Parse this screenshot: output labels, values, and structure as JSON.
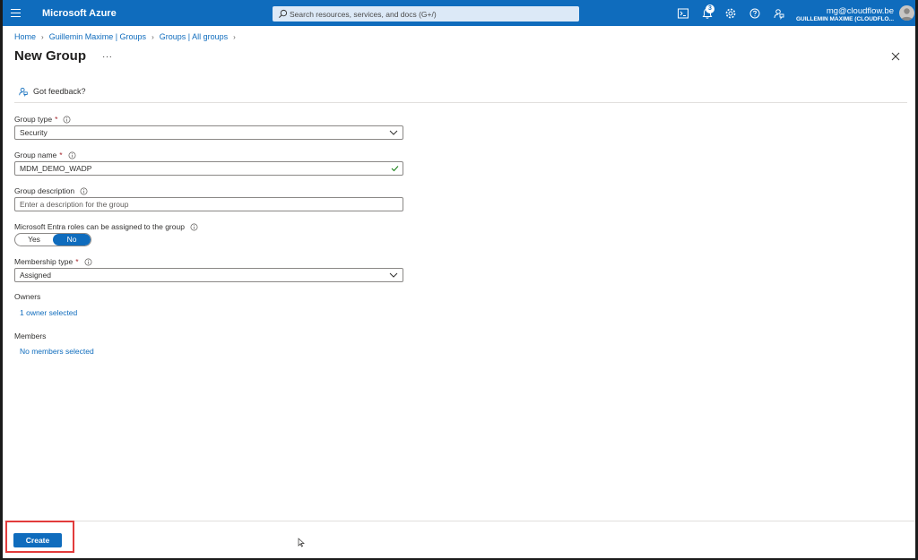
{
  "topbar": {
    "brand": "Microsoft Azure",
    "search_placeholder": "Search resources, services, and docs (G+/)",
    "notifications_count": "3",
    "user_email": "mg@cloudflow.be",
    "user_org": "GUILLEMIN MAXIME (CLOUDFLO...",
    "icons": [
      "menu-icon",
      "search-icon",
      "cloud-shell-icon",
      "notifications-icon",
      "settings-icon",
      "help-icon",
      "feedback-icon",
      "avatar"
    ],
    "accent_color": "#0f6cbd"
  },
  "breadcrumb": {
    "items": [
      "Home",
      "Guillemin Maxime | Groups",
      "Groups | All groups"
    ]
  },
  "page": {
    "title": "New Group",
    "more": "···"
  },
  "feedback": {
    "label": "Got feedback?"
  },
  "form": {
    "group_type": {
      "label": "Group type",
      "required": "*",
      "value": "Security"
    },
    "group_name": {
      "label": "Group name",
      "required": "*",
      "value": "MDM_DEMO_WADP"
    },
    "group_description": {
      "label": "Group description",
      "placeholder": "Enter a description for the group"
    },
    "entra_roles": {
      "label": "Microsoft Entra roles can be assigned to the group",
      "options": [
        "Yes",
        "No"
      ],
      "selected": "No"
    },
    "membership_type": {
      "label": "Membership type",
      "required": "*",
      "value": "Assigned"
    },
    "owners": {
      "label": "Owners",
      "link": "1 owner selected"
    },
    "members": {
      "label": "Members",
      "link": "No members selected"
    }
  },
  "footer": {
    "create_label": "Create",
    "highlight_color": "#e23b3b"
  }
}
